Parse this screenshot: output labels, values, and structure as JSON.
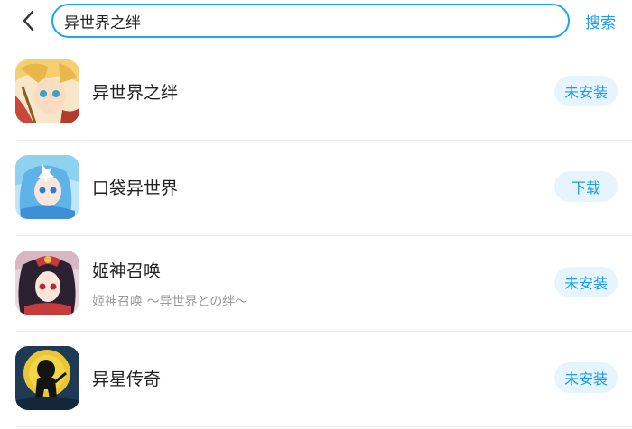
{
  "search": {
    "value": "异世界之绊",
    "button_label": "搜索"
  },
  "icons": {
    "back": "chevron-left-icon"
  },
  "colors": {
    "accent": "#1a9df0",
    "button_bg": "#e6f5fd",
    "divider": "#ececec"
  },
  "results": [
    {
      "name": "异世界之绊",
      "subtitle": "",
      "action": "未安装"
    },
    {
      "name": "口袋异世界",
      "subtitle": "",
      "action": "下载"
    },
    {
      "name": "姬神召唤",
      "subtitle": "姬神召唤 ～异世界との绊～",
      "action": "未安装"
    },
    {
      "name": "异星传奇",
      "subtitle": "",
      "action": "未安装"
    }
  ]
}
